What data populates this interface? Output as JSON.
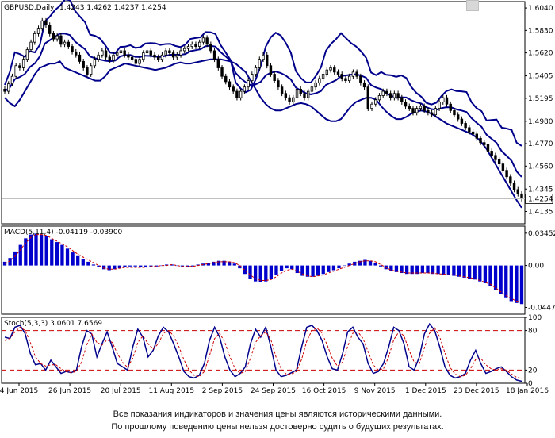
{
  "chart_data": {
    "type": "candlestick",
    "symbol_header": "GBPUSD,Daily",
    "ohlc_header": "1.4243 1.4262 1.4237 1.4254",
    "last_price": "1.4254",
    "colors": {
      "candle": "#000000",
      "bands": "#00008b",
      "macd_hist": "#0000cc",
      "macd_signal": "#cc0000",
      "stoch_main": "#00008b",
      "stoch_signal": "#cc0000",
      "stoch_levels": "#cc0000",
      "frame": "#000000",
      "price_line": "#c0c0c0"
    },
    "x_labels": [
      "4 Jun 2015",
      "26 Jun 2015",
      "20 Jul 2015",
      "11 Aug 2015",
      "2 Sep 2015",
      "24 Sep 2015",
      "16 Oct 2015",
      "9 Nov 2015",
      "1 Dec 2015",
      "23 Dec 2015",
      "18 Jan 2016"
    ],
    "price_panel": {
      "ylim": [
        1.402,
        1.61
      ],
      "y_ticks": [
        "1.6040",
        "1.5830",
        "1.5620",
        "1.5405",
        "1.5195",
        "1.4980",
        "1.4770",
        "1.4560",
        "1.4345",
        "1.4135"
      ],
      "close": [
        1.526,
        1.533,
        1.54,
        1.55,
        1.548,
        1.556,
        1.565,
        1.572,
        1.58,
        1.585,
        1.592,
        1.588,
        1.58,
        1.575,
        1.578,
        1.57,
        1.572,
        1.568,
        1.563,
        1.56,
        1.554,
        1.548,
        1.542,
        1.55,
        1.556,
        1.56,
        1.564,
        1.558,
        1.555,
        1.56,
        1.562,
        1.564,
        1.56,
        1.558,
        1.556,
        1.552,
        1.556,
        1.562,
        1.564,
        1.56,
        1.558,
        1.556,
        1.56,
        1.564,
        1.562,
        1.558,
        1.56,
        1.564,
        1.566,
        1.568,
        1.57,
        1.568,
        1.572,
        1.576,
        1.57,
        1.564,
        1.556,
        1.548,
        1.54,
        1.535,
        1.53,
        1.526,
        1.52,
        1.526,
        1.53,
        1.536,
        1.542,
        1.548,
        1.556,
        1.56,
        1.55,
        1.542,
        1.536,
        1.53,
        1.524,
        1.52,
        1.516,
        1.52,
        1.528,
        1.524,
        1.52,
        1.526,
        1.53,
        1.534,
        1.538,
        1.542,
        1.546,
        1.548,
        1.544,
        1.542,
        1.538,
        1.536,
        1.54,
        1.544,
        1.54,
        1.534,
        1.53,
        1.51,
        1.514,
        1.518,
        1.522,
        1.526,
        1.524,
        1.52,
        1.524,
        1.52,
        1.516,
        1.512,
        1.51,
        1.506,
        1.51,
        1.512,
        1.508,
        1.506,
        1.504,
        1.51,
        1.516,
        1.52,
        1.514,
        1.508,
        1.504,
        1.5,
        1.496,
        1.492,
        1.488,
        1.486,
        1.482,
        1.478,
        1.476,
        1.47,
        1.466,
        1.462,
        1.458,
        1.452,
        1.446,
        1.44,
        1.434,
        1.43,
        1.4254
      ],
      "lower_band": [
        1.52,
        1.515,
        1.512,
        1.518,
        1.526,
        1.534,
        1.542,
        1.548,
        1.55,
        1.552,
        1.552,
        1.554,
        1.548,
        1.546,
        1.544,
        1.542,
        1.54,
        1.538,
        1.536,
        1.536,
        1.54,
        1.546,
        1.548,
        1.55,
        1.552,
        1.551,
        1.55,
        1.549,
        1.548,
        1.547,
        1.546,
        1.547,
        1.548,
        1.55,
        1.552,
        1.553,
        1.552,
        1.552,
        1.553,
        1.554,
        1.555,
        1.556,
        1.556,
        1.556,
        1.555,
        1.554,
        1.552,
        1.548,
        1.544,
        1.536,
        1.528,
        1.52,
        1.514,
        1.51,
        1.508,
        1.508,
        1.51,
        1.512,
        1.514,
        1.515,
        1.514,
        1.512,
        1.508,
        1.504,
        1.5,
        1.498,
        1.498,
        1.5,
        1.506,
        1.512,
        1.516,
        1.518,
        1.52,
        1.52,
        1.518,
        1.512,
        1.507,
        1.503,
        1.5,
        1.5,
        1.502,
        1.505,
        1.507,
        1.508,
        1.507,
        1.505,
        1.502,
        1.499,
        1.496,
        1.494,
        1.492,
        1.49,
        1.488,
        1.486,
        1.483,
        1.478,
        1.472,
        1.464,
        1.456,
        1.448,
        1.44,
        1.432,
        1.424,
        1.417
      ]
    },
    "macd_panel": {
      "label": "MACD(5,11,4) -0.04119 -0.03900",
      "ylim": [
        -0.052,
        0.042
      ],
      "y_ticks": [
        "0.03452",
        "0.00",
        "-0.04479"
      ],
      "hist": [
        0.004,
        0.008,
        0.015,
        0.022,
        0.029,
        0.033,
        0.034,
        0.033,
        0.031,
        0.028,
        0.025,
        0.022,
        0.018,
        0.014,
        0.01,
        0.007,
        0.004,
        0.001,
        -0.002,
        -0.004,
        -0.005,
        -0.004,
        -0.003,
        -0.002,
        -0.001,
        -0.001,
        -0.002,
        -0.002,
        -0.001,
        -0.001,
        0.0,
        0.001,
        0.001,
        0.0,
        -0.001,
        -0.002,
        -0.001,
        0.001,
        0.002,
        0.003,
        0.004,
        0.005,
        0.005,
        0.004,
        0.002,
        -0.003,
        -0.009,
        -0.014,
        -0.017,
        -0.018,
        -0.017,
        -0.014,
        -0.01,
        -0.006,
        -0.003,
        -0.004,
        -0.008,
        -0.011,
        -0.012,
        -0.012,
        -0.011,
        -0.009,
        -0.007,
        -0.005,
        -0.003,
        0.0,
        0.002,
        0.004,
        0.005,
        0.006,
        0.005,
        0.003,
        -0.001,
        -0.004,
        -0.006,
        -0.007,
        -0.008,
        -0.009,
        -0.009,
        -0.009,
        -0.008,
        -0.008,
        -0.009,
        -0.009,
        -0.01,
        -0.01,
        -0.011,
        -0.012,
        -0.013,
        -0.014,
        -0.015,
        -0.017,
        -0.019,
        -0.022,
        -0.026,
        -0.03,
        -0.034,
        -0.038,
        -0.04,
        -0.0412
      ],
      "signal": [
        0.002,
        0.005,
        0.01,
        0.017,
        0.024,
        0.03,
        0.033,
        0.033,
        0.032,
        0.029,
        0.026,
        0.023,
        0.02,
        0.016,
        0.012,
        0.009,
        0.006,
        0.003,
        0.0,
        -0.003,
        -0.004,
        -0.004,
        -0.003,
        -0.002,
        -0.002,
        -0.002,
        -0.002,
        -0.002,
        -0.001,
        -0.001,
        0.0,
        0.0,
        0.001,
        0.0,
        -0.001,
        -0.001,
        -0.001,
        0.0,
        0.001,
        0.002,
        0.003,
        0.004,
        0.004,
        0.004,
        0.003,
        0.0,
        -0.005,
        -0.01,
        -0.014,
        -0.016,
        -0.016,
        -0.015,
        -0.012,
        -0.008,
        -0.005,
        -0.004,
        -0.006,
        -0.009,
        -0.011,
        -0.012,
        -0.011,
        -0.01,
        -0.008,
        -0.006,
        -0.004,
        -0.002,
        0.0,
        0.002,
        0.004,
        0.005,
        0.005,
        0.004,
        0.001,
        -0.002,
        -0.005,
        -0.006,
        -0.007,
        -0.008,
        -0.008,
        -0.008,
        -0.008,
        -0.008,
        -0.008,
        -0.009,
        -0.009,
        -0.01,
        -0.01,
        -0.011,
        -0.012,
        -0.013,
        -0.014,
        -0.016,
        -0.018,
        -0.02,
        -0.024,
        -0.028,
        -0.032,
        -0.035,
        -0.038,
        -0.039
      ]
    },
    "stoch_panel": {
      "label": "Stoch(5,3,3) 3.0601 7.6569",
      "ylim": [
        0,
        100
      ],
      "y_ticks": [
        "100",
        "80",
        "20",
        "0"
      ],
      "levels": [
        80,
        20
      ],
      "main": [
        70,
        68,
        85,
        88,
        75,
        45,
        28,
        30,
        20,
        35,
        25,
        15,
        18,
        16,
        20,
        55,
        80,
        75,
        40,
        60,
        78,
        55,
        30,
        25,
        20,
        55,
        82,
        70,
        40,
        50,
        72,
        85,
        78,
        60,
        40,
        18,
        10,
        8,
        12,
        30,
        65,
        85,
        70,
        40,
        20,
        10,
        15,
        25,
        60,
        82,
        70,
        85,
        55,
        20,
        10,
        12,
        16,
        20,
        55,
        85,
        88,
        80,
        65,
        40,
        22,
        20,
        45,
        78,
        85,
        70,
        60,
        30,
        15,
        18,
        30,
        55,
        85,
        80,
        60,
        25,
        20,
        40,
        75,
        90,
        80,
        55,
        25,
        12,
        8,
        10,
        15,
        35,
        50,
        30,
        15,
        18,
        22,
        25,
        18,
        10,
        5,
        3
      ],
      "signal": [
        65,
        68,
        78,
        85,
        80,
        62,
        40,
        30,
        26,
        28,
        28,
        22,
        18,
        16,
        18,
        32,
        58,
        75,
        62,
        58,
        66,
        62,
        45,
        32,
        24,
        38,
        62,
        72,
        60,
        52,
        60,
        76,
        80,
        72,
        56,
        36,
        20,
        12,
        10,
        18,
        42,
        68,
        76,
        62,
        40,
        22,
        15,
        18,
        38,
        62,
        72,
        78,
        66,
        40,
        22,
        14,
        14,
        18,
        36,
        64,
        80,
        84,
        76,
        58,
        38,
        26,
        32,
        56,
        76,
        78,
        68,
        48,
        28,
        20,
        22,
        40,
        66,
        78,
        72,
        50,
        32,
        30,
        54,
        76,
        84,
        70,
        46,
        24,
        14,
        10,
        12,
        22,
        36,
        38,
        28,
        22,
        20,
        22,
        20,
        14,
        9,
        7
      ]
    }
  },
  "footer": {
    "line1": "Все показания индикаторов и значения цены являются историческими данными.",
    "line2": "По прошлому поведению цены нельзя достоверно судить о будущих результатах."
  }
}
